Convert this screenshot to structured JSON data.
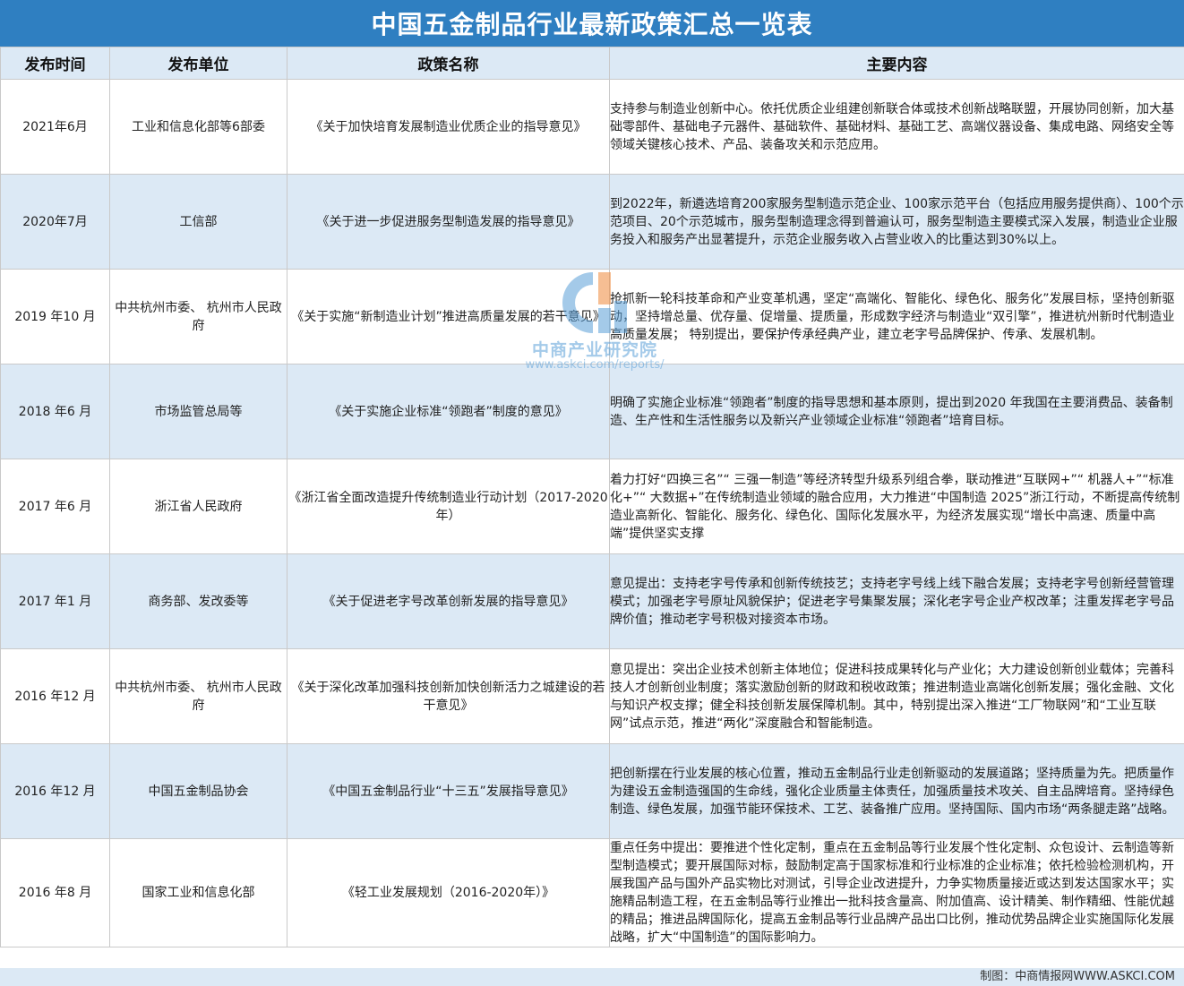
{
  "title": "中国五金制品行业最新政策汇总一览表",
  "headers": [
    "发布时间",
    "发布单位",
    "政策名称",
    "主要内容"
  ],
  "rows": [
    {
      "date": "2021年6月",
      "unit": "工业和信息化部等6部委",
      "name": "《关于加快培育发展制造业优质企业的指导意见》",
      "content": "支持参与制造业创新中心。依托优质企业组建创新联合体或技术创新战略联盟，开展协同创新，加大基础零部件、基础电子元器件、基础软件、基础材料、基础工艺、高端仪器设备、集成电路、网络安全等领域关键核心技术、产品、装备攻关和示范应用。"
    },
    {
      "date": "2020年7月",
      "unit": "工信部",
      "name": "《关于进一步促进服务型制造发展的指导意见》",
      "content": "到2022年，新遴选培育200家服务型制造示范企业、100家示范平台（包括应用服务提供商）、100个示范项目、20个示范城市，服务型制造理念得到普遍认可，服务型制造主要模式深入发展，制造业企业服务投入和服务产出显著提升，示范企业服务收入占营业收入的比重达到30%以上。"
    },
    {
      "date": "2019 年10 月",
      "unit": "中共杭州市委、 杭州市人民政府",
      "name": "《关于实施“新制造业计划”推进高质量发展的若干意见》",
      "content": "抢抓新一轮科技革命和产业变革机遇，坚定“高端化、智能化、绿色化、服务化”发展目标，坚持创新驱动，坚持增总量、优存量、促增量、提质量，形成数字经济与制造业“双引擎”，推进杭州新时代制造业高质量发展； 特别提出，要保护传承经典产业，建立老字号品牌保护、传承、发展机制。"
    },
    {
      "date": "2018 年6 月",
      "unit": "市场监管总局等",
      "name": "《关于实施企业标准“领跑者”制度的意见》",
      "content": "明确了实施企业标准“领跑者”制度的指导思想和基本原则，提出到2020 年我国在主要消费品、装备制造、生产性和生活性服务以及新兴产业领域企业标准“领跑者”培育目标。"
    },
    {
      "date": "2017 年6 月",
      "unit": "浙江省人民政府",
      "name": "《浙江省全面改造提升传统制造业行动计划（2017-2020年）",
      "content": "着力打好“四换三名”“ 三强一制造”等经济转型升级系列组合拳，联动推进“互联网+”“ 机器人+”“标准化+”“ 大数据+”在传统制造业领域的融合应用，大力推进“中国制造 2025”浙江行动，不断提高传统制造业高新化、智能化、服务化、绿色化、国际化发展水平，为经济发展实现“增长中高速、质量中高端”提供坚实支撑"
    },
    {
      "date": "2017 年1 月",
      "unit": "商务部、发改委等",
      "name": "《关于促进老字号改革创新发展的指导意见》",
      "content": "意见提出：支持老字号传承和创新传统技艺；支持老字号线上线下融合发展；支持老字号创新经营管理模式；加强老字号原址风貌保护；促进老字号集聚发展；深化老字号企业产权改革；注重发挥老字号品牌价值；推动老字号积极对接资本市场。"
    },
    {
      "date": "2016 年12 月",
      "unit": "中共杭州市委、 杭州市人民政府",
      "name": "《关于深化改革加强科技创新加快创新活力之城建设的若干意见》",
      "content": "意见提出：突出企业技术创新主体地位；促进科技成果转化与产业化；大力建设创新创业载体；完善科技人才创新创业制度；落实激励创新的财政和税收政策；推进制造业高端化创新发展；强化金融、文化与知识产权支撑；健全科技创新发展保障机制。其中，特别提出深入推进“工厂物联网”和“工业互联网”试点示范，推进“两化”深度融合和智能制造。"
    },
    {
      "date": "2016 年12 月",
      "unit": "中国五金制品协会",
      "name": "《中国五金制品行业“十三五”发展指导意见》",
      "content": "把创新摆在行业发展的核心位置，推动五金制品行业走创新驱动的发展道路；坚持质量为先。把质量作为建设五金制造强国的生命线，强化企业质量主体责任，加强质量技术攻关、自主品牌培育。坚持绿色制造、绿色发展，加强节能环保技术、工艺、装备推广应用。坚持国际、国内市场“两条腿走路”战略。"
    },
    {
      "date": "2016 年8 月",
      "unit": "国家工业和信息化部",
      "name": "《轻工业发展规划（2016-2020年）》",
      "content": "重点任务中提出：要推进个性化定制，重点在五金制品等行业发展个性化定制、众包设计、云制造等新型制造模式；要开展国际对标，鼓励制定高于国家标准和行业标准的企业标准；依托检验检测机构，开展我国产品与国外产品实物比对测试，引导企业改进提升，力争实物质量接近或达到发达国家水平；实施精品制造工程，在五金制品等行业推出一批科技含量高、附加值高、设计精美、制作精细、性能优越的精品；推进品牌国际化，提高五金制品等行业品牌产品出口比例，推动优势品牌企业实施国际化发展战略，扩大“中国制造”的国际影响力。"
    }
  ],
  "watermark": {
    "text": "中商产业研究院",
    "url": "www.askci.com/reports/"
  },
  "footer": "制图：中商情报网WWW.ASKCI.COM",
  "colors": {
    "title_bg": "#2f7fc1",
    "header_bg": "#dce9f5",
    "stripe_bg": "#dce9f5",
    "border": "#c9c9c9"
  }
}
